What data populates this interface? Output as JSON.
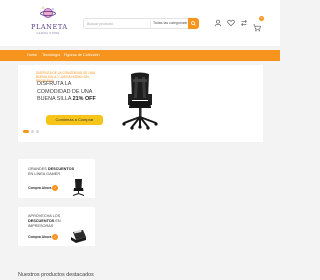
{
  "header": {
    "logo_text": "PLANETA",
    "logo_sub": "GAMING STORE",
    "search_placeholder": "Buscar producto",
    "category_select": "Todas las categorías",
    "cart_count": "0"
  },
  "icons": {
    "search": "search-icon",
    "user": "user-icon",
    "heart": "heart-icon",
    "compare": "compare-icon",
    "cart": "cart-icon"
  },
  "nav": {
    "items": [
      {
        "label": "Home"
      },
      {
        "label": "Tecnología"
      },
      {
        "label": "Figuras de Colección"
      }
    ]
  },
  "hero": {
    "kicker": "Disfruta de la comodidad de una buena silla y juega horas sin problema",
    "title_pre": "Disfruta la comodidad de una buena silla",
    "title_bold": "21% OFF",
    "button": "Comienza a Comprar",
    "slides": 3,
    "active_slide": 1
  },
  "promos": [
    {
      "title_pre": "Grandes",
      "title_bold": "descuentos",
      "title_post": "en Línea Gamer",
      "link": "Compra Ahora"
    },
    {
      "title_pre": "Aprovecha los",
      "title_bold": "descuentos",
      "title_post": "en Impresoras",
      "link": "Compra Ahora"
    }
  ],
  "section": {
    "title": "Nuestros productos destacados"
  },
  "colors": {
    "accent": "#f7941d",
    "button_yellow": "#f7c51a",
    "logo_purple": "#5a3d8a",
    "background": "#f3f3f3"
  }
}
